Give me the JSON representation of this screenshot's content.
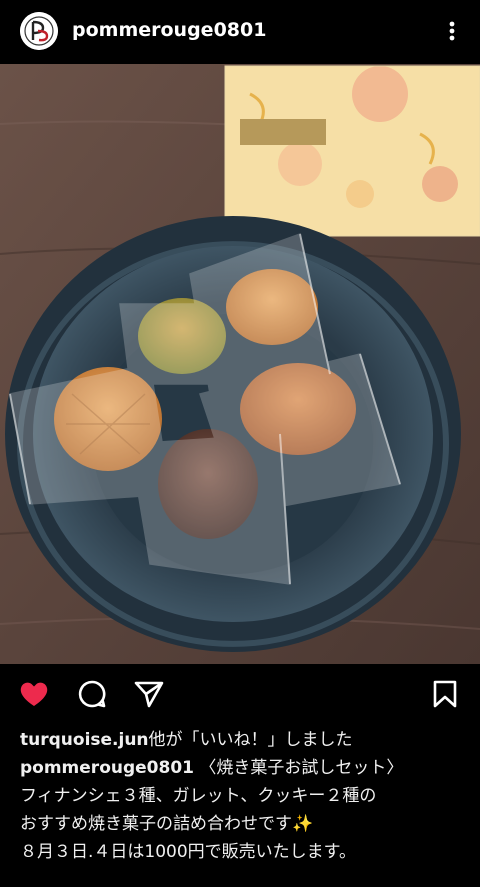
{
  "post": {
    "username": "pommerouge0801"
  },
  "icons": {
    "avatar": "pommerouge-logo",
    "more": "more-vertical-icon",
    "like": "heart-icon",
    "comment": "comment-icon",
    "share": "send-icon",
    "save": "bookmark-icon"
  },
  "colors": {
    "like": "#ed2a4d",
    "background": "#000000"
  },
  "likes": {
    "user": "turquoise.jun",
    "text": "他が「いいね！」しました"
  },
  "caption": {
    "username": "pommerouge0801",
    "line1": "〈焼き菓子お試しセット〉",
    "line2": "フィナンシェ３種、ガレット、クッキー２種の",
    "line3": "おすすめ焼き菓子の詰め合わせです✨",
    "line4": "８月３日.４日は1000円で販売いたします。"
  }
}
